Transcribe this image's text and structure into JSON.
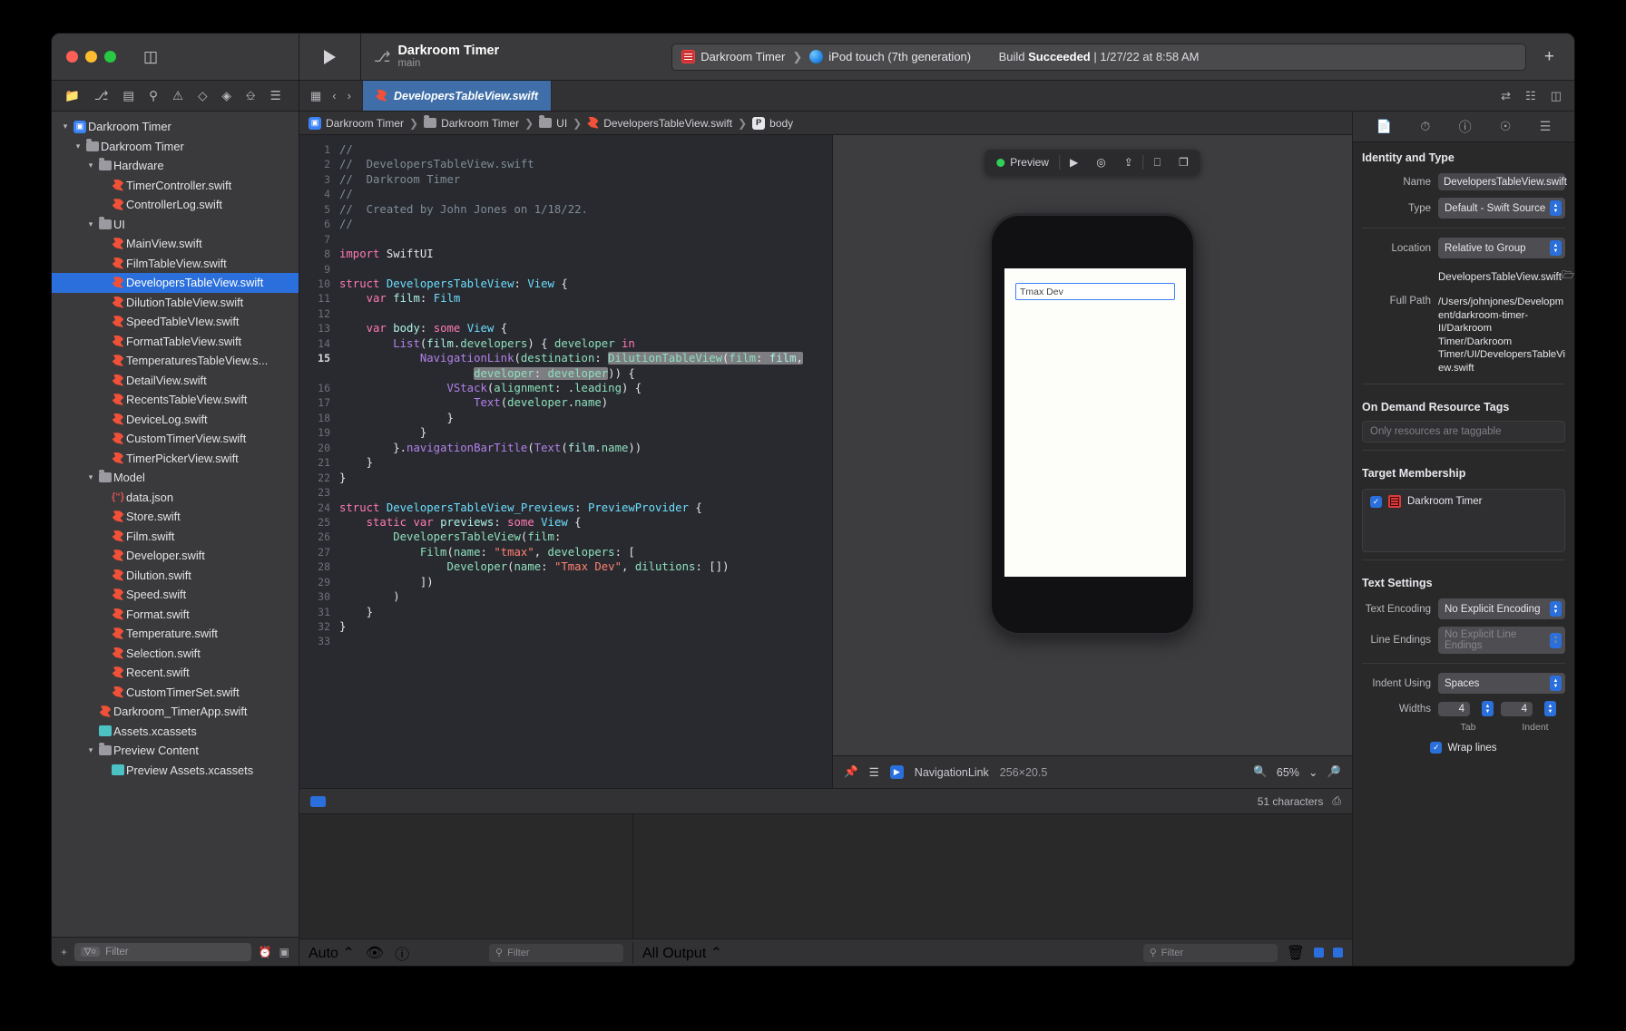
{
  "window": {
    "traffic_lights": [
      "close",
      "minimize",
      "zoom"
    ]
  },
  "toolbar": {
    "scheme_name": "Darkroom Timer",
    "scheme_branch": "main",
    "destination_scheme": "Darkroom Timer",
    "destination_device": "iPod touch (7th generation)",
    "build_status_prefix": "Build",
    "build_status_result": "Succeeded",
    "build_status_time": "| 1/27/22 at 8:58 AM",
    "add_label": "+"
  },
  "tabbar": {
    "active_tab": "DevelopersTableView.swift",
    "back_label": "‹",
    "forward_label": "›"
  },
  "navigator": {
    "filter_placeholder": "Filter",
    "filter_pill": "▽○",
    "items": [
      {
        "label": "Darkroom Timer",
        "indent": 0,
        "icon": "project-icon",
        "disclosure": "open",
        "selected": false
      },
      {
        "label": "Darkroom Timer",
        "indent": 1,
        "icon": "folder-icon",
        "disclosure": "open",
        "selected": false
      },
      {
        "label": "Hardware",
        "indent": 2,
        "icon": "folder-icon",
        "disclosure": "open",
        "selected": false
      },
      {
        "label": "TimerController.swift",
        "indent": 3,
        "icon": "swift-icon",
        "disclosure": "none",
        "selected": false
      },
      {
        "label": "ControllerLog.swift",
        "indent": 3,
        "icon": "swift-icon",
        "disclosure": "none",
        "selected": false
      },
      {
        "label": "UI",
        "indent": 2,
        "icon": "folder-icon",
        "disclosure": "open",
        "selected": false
      },
      {
        "label": "MainView.swift",
        "indent": 3,
        "icon": "swift-icon",
        "disclosure": "none",
        "selected": false
      },
      {
        "label": "FilmTableView.swift",
        "indent": 3,
        "icon": "swift-icon",
        "disclosure": "none",
        "selected": false
      },
      {
        "label": "DevelopersTableView.swift",
        "indent": 3,
        "icon": "swift-icon",
        "disclosure": "none",
        "selected": true
      },
      {
        "label": "DilutionTableView.swift",
        "indent": 3,
        "icon": "swift-icon",
        "disclosure": "none",
        "selected": false
      },
      {
        "label": "SpeedTableVIew.swift",
        "indent": 3,
        "icon": "swift-icon",
        "disclosure": "none",
        "selected": false
      },
      {
        "label": "FormatTableView.swift",
        "indent": 3,
        "icon": "swift-icon",
        "disclosure": "none",
        "selected": false
      },
      {
        "label": "TemperaturesTableView.s...",
        "indent": 3,
        "icon": "swift-icon",
        "disclosure": "none",
        "selected": false
      },
      {
        "label": "DetailView.swift",
        "indent": 3,
        "icon": "swift-icon",
        "disclosure": "none",
        "selected": false
      },
      {
        "label": "RecentsTableView.swift",
        "indent": 3,
        "icon": "swift-icon",
        "disclosure": "none",
        "selected": false
      },
      {
        "label": "DeviceLog.swift",
        "indent": 3,
        "icon": "swift-icon",
        "disclosure": "none",
        "selected": false
      },
      {
        "label": "CustomTimerView.swift",
        "indent": 3,
        "icon": "swift-icon",
        "disclosure": "none",
        "selected": false
      },
      {
        "label": "TimerPickerView.swift",
        "indent": 3,
        "icon": "swift-icon",
        "disclosure": "none",
        "selected": false
      },
      {
        "label": "Model",
        "indent": 2,
        "icon": "folder-icon",
        "disclosure": "open",
        "selected": false
      },
      {
        "label": "data.json",
        "indent": 3,
        "icon": "json-icon",
        "disclosure": "none",
        "selected": false
      },
      {
        "label": "Store.swift",
        "indent": 3,
        "icon": "swift-icon",
        "disclosure": "none",
        "selected": false
      },
      {
        "label": "Film.swift",
        "indent": 3,
        "icon": "swift-icon",
        "disclosure": "none",
        "selected": false
      },
      {
        "label": "Developer.swift",
        "indent": 3,
        "icon": "swift-icon",
        "disclosure": "none",
        "selected": false
      },
      {
        "label": "Dilution.swift",
        "indent": 3,
        "icon": "swift-icon",
        "disclosure": "none",
        "selected": false
      },
      {
        "label": "Speed.swift",
        "indent": 3,
        "icon": "swift-icon",
        "disclosure": "none",
        "selected": false
      },
      {
        "label": "Format.swift",
        "indent": 3,
        "icon": "swift-icon",
        "disclosure": "none",
        "selected": false
      },
      {
        "label": "Temperature.swift",
        "indent": 3,
        "icon": "swift-icon",
        "disclosure": "none",
        "selected": false
      },
      {
        "label": "Selection.swift",
        "indent": 3,
        "icon": "swift-icon",
        "disclosure": "none",
        "selected": false
      },
      {
        "label": "Recent.swift",
        "indent": 3,
        "icon": "swift-icon",
        "disclosure": "none",
        "selected": false
      },
      {
        "label": "CustomTimerSet.swift",
        "indent": 3,
        "icon": "swift-icon",
        "disclosure": "none",
        "selected": false
      },
      {
        "label": "Darkroom_TimerApp.swift",
        "indent": 2,
        "icon": "swift-icon",
        "disclosure": "none",
        "selected": false
      },
      {
        "label": "Assets.xcassets",
        "indent": 2,
        "icon": "assets-icon",
        "disclosure": "none",
        "selected": false
      },
      {
        "label": "Preview Content",
        "indent": 2,
        "icon": "folder-icon",
        "disclosure": "open",
        "selected": false
      },
      {
        "label": "Preview Assets.xcassets",
        "indent": 3,
        "icon": "assets-icon",
        "disclosure": "none",
        "selected": false
      }
    ]
  },
  "jumpbar": {
    "crumbs": [
      "Darkroom Timer",
      "Darkroom Timer",
      "UI",
      "DevelopersTableView.swift",
      "body"
    ],
    "body_badge": "P"
  },
  "code": {
    "lines": [
      {
        "n": "1",
        "html": "<span class='c-comment'>//</span>"
      },
      {
        "n": "2",
        "html": "<span class='c-comment'>//  DevelopersTableView.swift</span>"
      },
      {
        "n": "3",
        "html": "<span class='c-comment'>//  Darkroom Timer</span>"
      },
      {
        "n": "4",
        "html": "<span class='c-comment'>//</span>"
      },
      {
        "n": "5",
        "html": "<span class='c-comment'>//  Created by John Jones on 1/18/22.</span>"
      },
      {
        "n": "6",
        "html": "<span class='c-comment'>//</span>"
      },
      {
        "n": "7",
        "html": ""
      },
      {
        "n": "8",
        "html": "<span class='c-kw'>import</span> <span class='c-plain'>SwiftUI</span>"
      },
      {
        "n": "9",
        "html": ""
      },
      {
        "n": "10",
        "html": "<span class='c-kw'>struct</span> <span class='c-type'>DevelopersTableView</span><span class='c-plain'>: </span><span class='c-type'>View</span><span class='c-plain'> {</span>"
      },
      {
        "n": "11",
        "html": "    <span class='c-kw'>var</span> <span class='c-var'>film</span><span class='c-plain'>: </span><span class='c-type'>Film</span>"
      },
      {
        "n": "12",
        "html": ""
      },
      {
        "n": "13",
        "html": "    <span class='c-kw'>var</span> <span class='c-var'>body</span><span class='c-plain'>: </span><span class='c-kw'>some</span> <span class='c-type'>View</span><span class='c-plain'> {</span>"
      },
      {
        "n": "14",
        "html": "        <span class='c-call'>List</span><span class='c-plain'>(</span><span class='c-var'>film</span><span class='c-plain'>.</span><span class='c-prop'>developers</span><span class='c-plain'>) { </span><span class='c-prop'>developer</span> <span class='c-kw'>in</span>"
      },
      {
        "n": "15",
        "cur": true,
        "html": "            <span class='c-call'>NavigationLink</span><span class='c-plain'>(</span><span class='c-prop'>destination</span><span class='c-plain'>: </span><span class='sel'><span class='c-prop'>DilutionTableView</span><span class='c-plain'>(</span><span class='c-prop'>film</span><span class='c-plain'>: </span><span class='c-var'>film</span><span class='c-plain'>,</span></span>"
      },
      {
        "n": "",
        "html": "                    <span class='sel'><span class='c-prop'>developer</span><span class='c-plain'>: </span><span class='c-prop'>developer</span></span><span class='c-plain'>)) {</span>"
      },
      {
        "n": "16",
        "html": "                <span class='c-call'>VStack</span><span class='c-plain'>(</span><span class='c-prop'>alignment</span><span class='c-plain'>: .</span><span class='c-prop'>leading</span><span class='c-plain'>) {</span>"
      },
      {
        "n": "17",
        "html": "                    <span class='c-call'>Text</span><span class='c-plain'>(</span><span class='c-prop'>developer</span><span class='c-plain'>.</span><span class='c-prop'>name</span><span class='c-plain'>)</span>"
      },
      {
        "n": "18",
        "html": "                <span class='c-plain'>}</span>"
      },
      {
        "n": "19",
        "html": "            <span class='c-plain'>}</span>"
      },
      {
        "n": "20",
        "html": "        <span class='c-plain'>}.</span><span class='c-call'>navigationBarTitle</span><span class='c-plain'>(</span><span class='c-call'>Text</span><span class='c-plain'>(</span><span class='c-var'>film</span><span class='c-plain'>.</span><span class='c-prop'>name</span><span class='c-plain'>))</span>"
      },
      {
        "n": "21",
        "html": "    <span class='c-plain'>}</span>"
      },
      {
        "n": "22",
        "html": "<span class='c-plain'>}</span>"
      },
      {
        "n": "23",
        "html": ""
      },
      {
        "n": "24",
        "html": "<span class='c-kw'>struct</span> <span class='c-type'>DevelopersTableView_Previews</span><span class='c-plain'>: </span><span class='c-type'>PreviewProvider</span><span class='c-plain'> {</span>"
      },
      {
        "n": "25",
        "html": "    <span class='c-kw'>static var</span> <span class='c-var'>previews</span><span class='c-plain'>: </span><span class='c-kw'>some</span> <span class='c-type'>View</span><span class='c-plain'> {</span>"
      },
      {
        "n": "26",
        "html": "        <span class='c-prop'>DevelopersTableView</span><span class='c-plain'>(</span><span class='c-prop'>film</span><span class='c-plain'>:</span>"
      },
      {
        "n": "27",
        "html": "            <span class='c-prop'>Film</span><span class='c-plain'>(</span><span class='c-prop'>name</span><span class='c-plain'>: </span><span class='c-str'>\"tmax\"</span><span class='c-plain'>, </span><span class='c-prop'>developers</span><span class='c-plain'>: [</span>"
      },
      {
        "n": "28",
        "html": "                <span class='c-prop'>Developer</span><span class='c-plain'>(</span><span class='c-prop'>name</span><span class='c-plain'>: </span><span class='c-str'>\"Tmax Dev\"</span><span class='c-plain'>, </span><span class='c-prop'>dilutions</span><span class='c-plain'>: [])</span>"
      },
      {
        "n": "29",
        "html": "            <span class='c-plain'>])</span>"
      },
      {
        "n": "30",
        "html": "        <span class='c-plain'>)</span>"
      },
      {
        "n": "31",
        "html": "    <span class='c-plain'>}</span>"
      },
      {
        "n": "32",
        "html": "<span class='c-plain'>}</span>"
      },
      {
        "n": "33",
        "html": ""
      }
    ]
  },
  "preview": {
    "toolbar_label": "Preview",
    "device_field_text": "Tmax Dev",
    "bottom_selection": "NavigationLink",
    "bottom_dimensions": "256×20.5",
    "zoom_level": "65%"
  },
  "status_bar": {
    "characters": "51 characters"
  },
  "inspector": {
    "identity": {
      "section_title": "Identity and Type",
      "name_label": "Name",
      "name_value": "DevelopersTableView.swift",
      "type_label": "Type",
      "type_value": "Default - Swift Source",
      "location_label": "Location",
      "location_value": "Relative to Group",
      "location_file": "DevelopersTableView.swift",
      "fullpath_label": "Full Path",
      "fullpath_value": "/Users/johnjones/Development/darkroom-timer-II/Darkroom Timer/Darkroom Timer/UI/DevelopersTableView.swift"
    },
    "odr": {
      "section_title": "On Demand Resource Tags",
      "placeholder": "Only resources are taggable"
    },
    "target_membership": {
      "section_title": "Target Membership",
      "target_name": "Darkroom Timer",
      "checked": true
    },
    "text_settings": {
      "section_title": "Text Settings",
      "encoding_label": "Text Encoding",
      "encoding_value": "No Explicit Encoding",
      "line_endings_label": "Line Endings",
      "line_endings_value": "No Explicit Line Endings",
      "indent_label": "Indent Using",
      "indent_value": "Spaces",
      "widths_label": "Widths",
      "tab_width": "4",
      "indent_width": "4",
      "tab_sublabel": "Tab",
      "indent_sublabel": "Indent",
      "wrap_lines_label": "Wrap lines",
      "wrap_lines_checked": true
    }
  },
  "debug": {
    "auto_label": "Auto ⌃",
    "vars_filter_placeholder": "Filter",
    "output_label": "All Output ⌃",
    "console_filter_placeholder": "Filter"
  }
}
